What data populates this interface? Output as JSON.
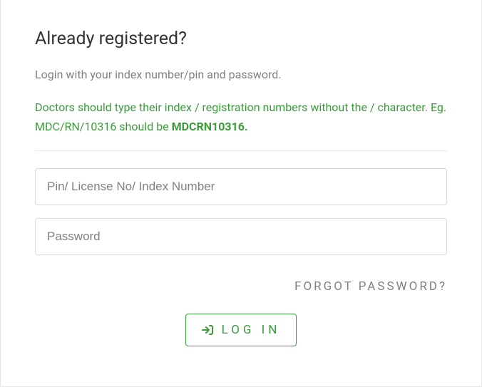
{
  "header": {
    "title": "Already registered?",
    "subtitle": "Login with your index number/pin and password.",
    "notice_prefix": "Doctors should type their index / registration numbers without the / character. Eg. MDC/RN/10316 should be ",
    "notice_bold": "MDCRN10316."
  },
  "form": {
    "username_placeholder": "Pin/ License No/ Index Number",
    "password_placeholder": "Password",
    "forgot_label": "FORGOT PASSWORD?",
    "login_label": "LOG IN"
  }
}
